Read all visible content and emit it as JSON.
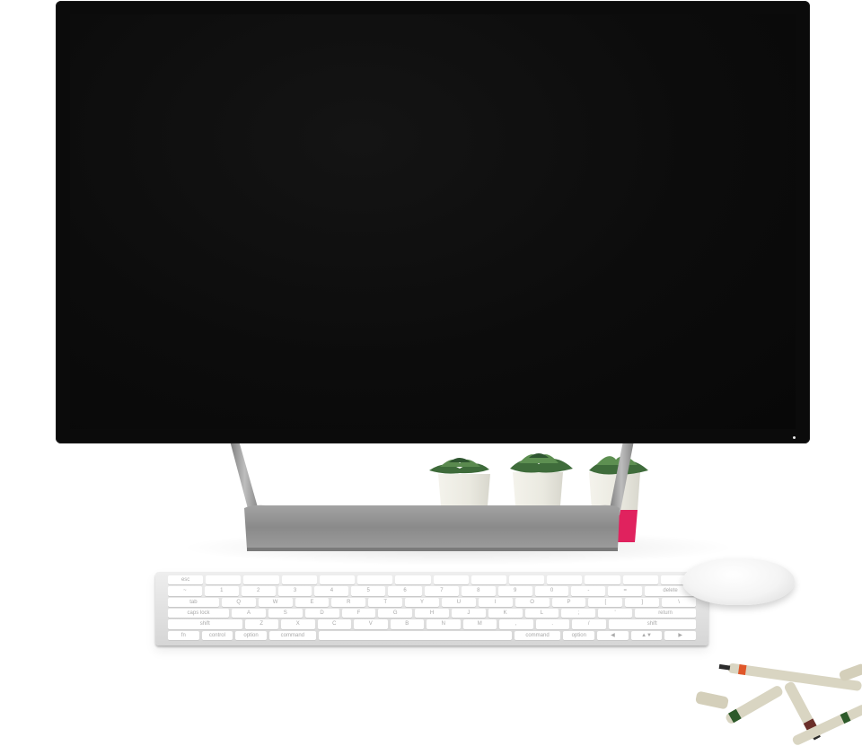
{
  "scene": {
    "description_items": [
      "monitor",
      "stand",
      "succulent-plants",
      "keyboard",
      "mouse",
      "pens"
    ]
  },
  "keyboard": {
    "rows": [
      [
        "esc",
        "",
        "",
        "",
        "",
        "",
        "",
        "",
        "",
        "",
        "",
        "",
        "",
        ""
      ],
      [
        "~",
        "1",
        "2",
        "3",
        "4",
        "5",
        "6",
        "7",
        "8",
        "9",
        "0",
        "-",
        "=",
        "delete"
      ],
      [
        "tab",
        "Q",
        "W",
        "E",
        "R",
        "T",
        "Y",
        "U",
        "I",
        "O",
        "P",
        "[",
        "]",
        "\\"
      ],
      [
        "caps lock",
        "A",
        "S",
        "D",
        "F",
        "G",
        "H",
        "J",
        "K",
        "L",
        ";",
        "'",
        "return"
      ],
      [
        "shift",
        "Z",
        "X",
        "C",
        "V",
        "B",
        "N",
        "M",
        ",",
        ".",
        "/",
        "shift"
      ],
      [
        "fn",
        "control",
        "option",
        "command",
        "",
        "command",
        "option",
        "◀",
        "▲▼",
        "▶"
      ]
    ]
  },
  "colors": {
    "monitor": "#0b0b0b",
    "stand": "#8e8e8e",
    "pot": "#efeee6",
    "pot_accent": "#e0225e",
    "pen_body": "#d9d5c2",
    "pen_band_orange": "#e0572a",
    "pen_band_green": "#2d5a2a"
  }
}
